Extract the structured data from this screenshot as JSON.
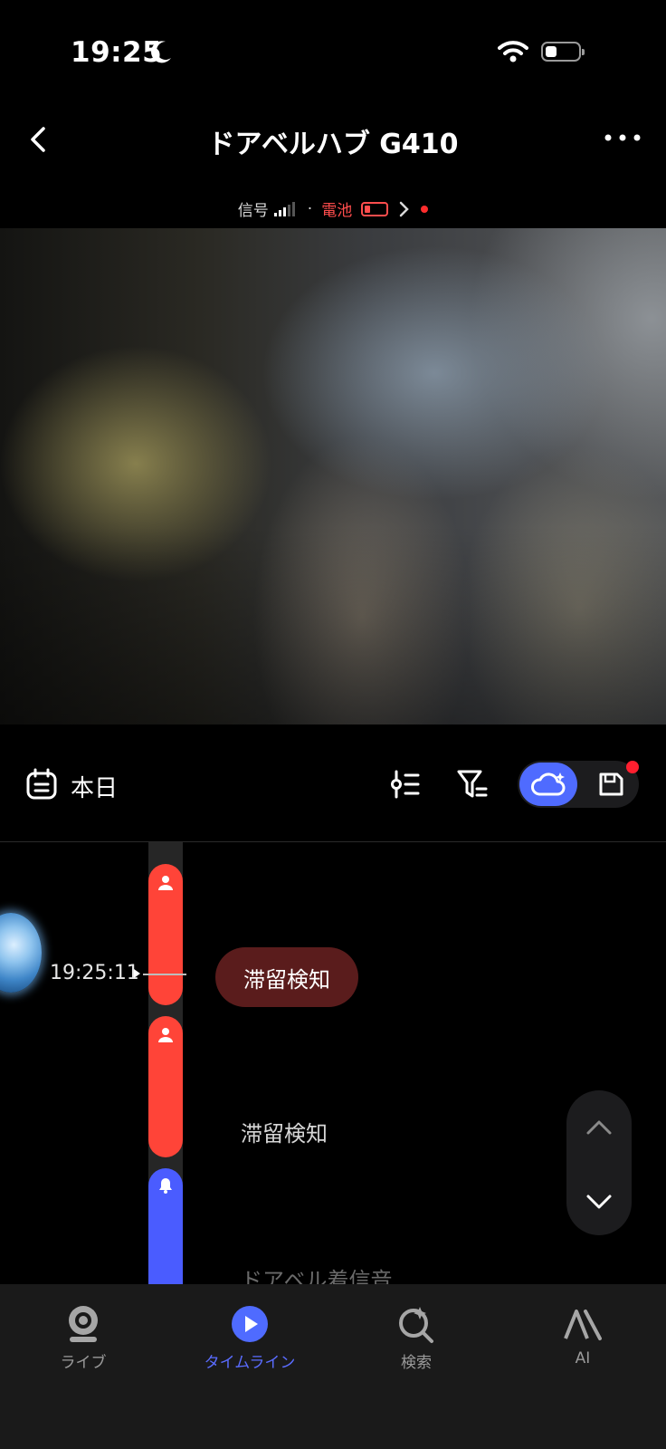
{
  "status_bar": {
    "time": "19:25"
  },
  "header": {
    "title": "ドアベルハブ G410"
  },
  "device_status": {
    "signal_label": "信号",
    "battery_label": "電池"
  },
  "toolbar": {
    "date_label": "本日"
  },
  "timeline": {
    "timestamp": "19:25:11",
    "events": [
      {
        "label": "滞留検知",
        "type": "person",
        "color": "#ff4438",
        "selected": true
      },
      {
        "label": "滞留検知",
        "type": "person",
        "color": "#ff4438",
        "selected": false
      },
      {
        "label": "ドアベル着信音",
        "type": "bell",
        "color": "#4a5cff",
        "selected": false
      }
    ]
  },
  "bottom_nav": {
    "items": [
      {
        "label": "ライブ",
        "icon": "camera-icon",
        "active": false
      },
      {
        "label": "タイムライン",
        "icon": "play-icon",
        "active": true
      },
      {
        "label": "検索",
        "icon": "ai-search-icon",
        "active": false
      },
      {
        "label": "AI",
        "icon": "ai-icon",
        "active": false
      }
    ]
  },
  "colors": {
    "accent": "#4f6bff",
    "event_red": "#ff4438",
    "event_blue": "#4a5cff",
    "alert_red": "#ff1f2f"
  }
}
